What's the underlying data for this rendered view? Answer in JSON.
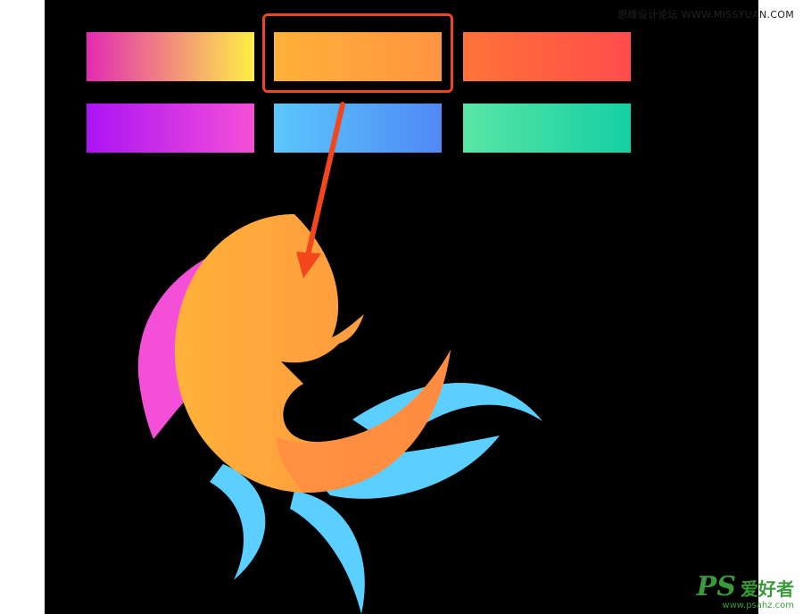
{
  "watermark": {
    "top_text": "思缘设计论坛 WWW.MISSYUAN.COM",
    "ps_logo": "PS",
    "cn_text": "爱好者",
    "url": "www.psahz.com"
  },
  "swatches": [
    {
      "name": "magenta-yellow",
      "from": "#e32bb3",
      "to": "#ffef45"
    },
    {
      "name": "orange",
      "from": "#ffb13a",
      "to": "#ff9440"
    },
    {
      "name": "orange-red",
      "from": "#ff7338",
      "to": "#ff4c4b"
    },
    {
      "name": "violet-pink",
      "from": "#aa14f5",
      "to": "#f54fd7"
    },
    {
      "name": "sky-blue",
      "from": "#5ac8fb",
      "to": "#5088f6"
    },
    {
      "name": "mint-teal",
      "from": "#59e6a5",
      "to": "#14cfa3"
    }
  ],
  "colors": {
    "canvas": "#000000",
    "highlight": "#e8481f",
    "arrow": "#f2461c",
    "fish_back": "#f44fd9",
    "fish_tail": "#5bcfff"
  }
}
